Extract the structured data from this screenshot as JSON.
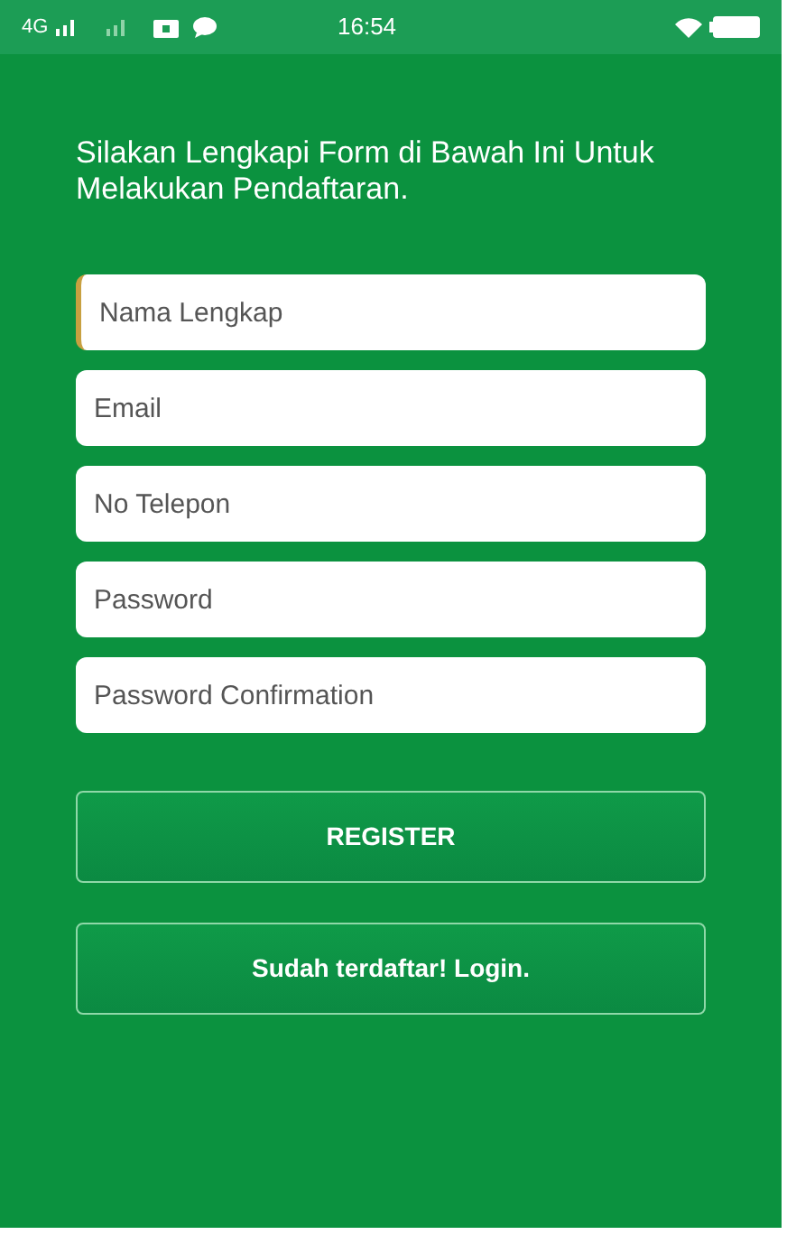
{
  "status_bar": {
    "network": "4G",
    "time": "16:54"
  },
  "heading": "Silakan Lengkapi Form di Bawah Ini Untuk Melakukan Pendaftaran.",
  "fields": [
    {
      "placeholder": "Nama Lengkap",
      "focused": true
    },
    {
      "placeholder": "Email",
      "focused": false
    },
    {
      "placeholder": "No Telepon",
      "focused": false
    },
    {
      "placeholder": "Password",
      "focused": false
    },
    {
      "placeholder": "Password Confirmation",
      "focused": false
    }
  ],
  "buttons": [
    {
      "label": "REGISTER"
    },
    {
      "label": "Sudah terdaftar! Login."
    }
  ]
}
